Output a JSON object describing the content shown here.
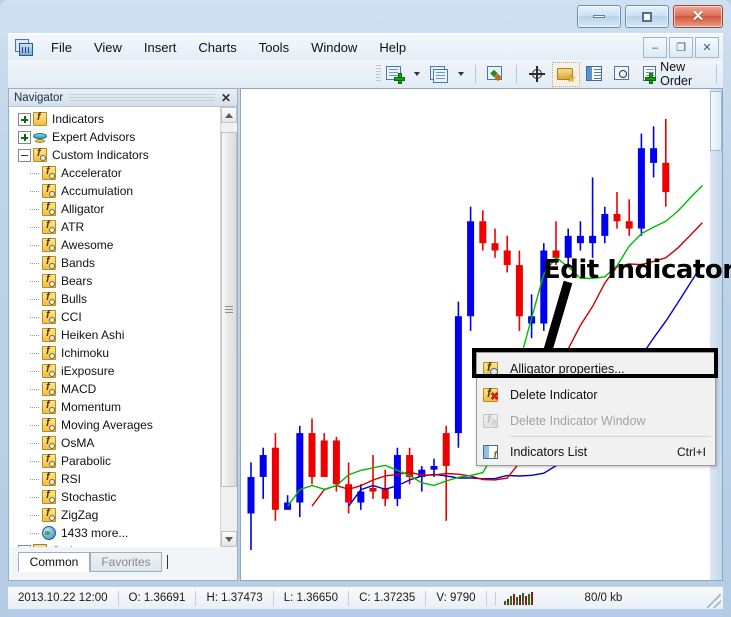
{
  "window": {
    "titlebar_buttons": [
      {
        "name": "minimize",
        "glyph": "minimize"
      },
      {
        "name": "restore",
        "glyph": "restore"
      },
      {
        "name": "close",
        "glyph": "×"
      }
    ]
  },
  "menubar": {
    "logo_icon": "app-chart-icon",
    "items": [
      "File",
      "View",
      "Insert",
      "Charts",
      "Tools",
      "Window",
      "Help"
    ],
    "mdi_buttons": [
      "–",
      "❐",
      "✕"
    ]
  },
  "toolbar": {
    "items": [
      {
        "name": "new-chart-button",
        "icon": "new-chart-icon",
        "label": "",
        "dropdown": true
      },
      {
        "name": "profiles-button",
        "icon": "profiles-icon",
        "label": "",
        "dropdown": true
      },
      {
        "name": "indicators-button",
        "icon": "indicators-icon",
        "label": ""
      },
      {
        "name": "crosshair-button",
        "icon": "crosshair-icon",
        "label": ""
      },
      {
        "name": "objects-button",
        "icon": "favorites-folder-icon",
        "label": ""
      },
      {
        "name": "terminal-button",
        "icon": "list-icon",
        "label": ""
      },
      {
        "name": "data-window-button",
        "icon": "magnifier-icon",
        "label": ""
      },
      {
        "name": "new-order-button",
        "icon": "new-order-icon",
        "label": "New Order"
      }
    ],
    "new_order_label": "New Order"
  },
  "navigator": {
    "title": "Navigator",
    "close_label": "✕",
    "tree": [
      {
        "label": "Indicators",
        "icon": "fx-icon",
        "level": 0,
        "expander": "plus"
      },
      {
        "label": "Expert Advisors",
        "icon": "hat-icon",
        "level": 0,
        "expander": "plus"
      },
      {
        "label": "Custom Indicators",
        "icon": "fx-sub-icon",
        "level": 0,
        "expander": "minus"
      },
      {
        "label": "Accelerator",
        "icon": "fx-sub-icon",
        "level": 1
      },
      {
        "label": "Accumulation",
        "icon": "fx-sub-icon",
        "level": 1
      },
      {
        "label": "Alligator",
        "icon": "fx-sub-icon",
        "level": 1
      },
      {
        "label": "ATR",
        "icon": "fx-sub-icon",
        "level": 1
      },
      {
        "label": "Awesome",
        "icon": "fx-sub-icon",
        "level": 1
      },
      {
        "label": "Bands",
        "icon": "fx-sub-icon",
        "level": 1
      },
      {
        "label": "Bears",
        "icon": "fx-sub-icon",
        "level": 1
      },
      {
        "label": "Bulls",
        "icon": "fx-sub-icon",
        "level": 1
      },
      {
        "label": "CCI",
        "icon": "fx-sub-icon",
        "level": 1
      },
      {
        "label": "Heiken Ashi",
        "icon": "fx-sub-icon",
        "level": 1
      },
      {
        "label": "Ichimoku",
        "icon": "fx-sub-icon",
        "level": 1
      },
      {
        "label": "iExposure",
        "icon": "fx-sub-icon",
        "level": 1
      },
      {
        "label": "MACD",
        "icon": "fx-sub-icon",
        "level": 1
      },
      {
        "label": "Momentum",
        "icon": "fx-sub-icon",
        "level": 1
      },
      {
        "label": "Moving Averages",
        "icon": "fx-sub-icon",
        "level": 1
      },
      {
        "label": "OsMA",
        "icon": "fx-sub-icon",
        "level": 1
      },
      {
        "label": "Parabolic",
        "icon": "fx-sub-icon",
        "level": 1
      },
      {
        "label": "RSI",
        "icon": "fx-sub-icon",
        "level": 1
      },
      {
        "label": "Stochastic",
        "icon": "fx-sub-icon",
        "level": 1
      },
      {
        "label": "ZigZag",
        "icon": "fx-sub-icon",
        "level": 1
      },
      {
        "label": "1433 more...",
        "icon": "globe-icon",
        "level": 1
      },
      {
        "label": "Scripts",
        "icon": "scroll-icon",
        "level": 0,
        "expander": "plus"
      }
    ],
    "tabs": [
      {
        "label": "Common",
        "active": true
      },
      {
        "label": "Favorites",
        "active": false
      }
    ]
  },
  "chart": {
    "annotation": "Edit Indicator"
  },
  "context_menu": {
    "items": [
      {
        "label": "Alligator properties...",
        "icon": "fx-gear-icon",
        "shortcut": "",
        "disabled": false,
        "highlighted": true
      },
      {
        "label": "Delete Indicator",
        "icon": "fx-delete-icon",
        "shortcut": "",
        "disabled": false,
        "highlighted": false
      },
      {
        "label": "Delete Indicator Window",
        "icon": "fx-delete-window-icon",
        "shortcut": "",
        "disabled": true,
        "highlighted": false
      },
      {
        "label": "Indicators List",
        "icon": "indicators-list-icon",
        "shortcut": "Ctrl+I",
        "disabled": false,
        "highlighted": false
      }
    ]
  },
  "statusbar": {
    "datetime": "2013.10.22 12:00",
    "open": "O: 1.36691",
    "high": "H: 1.37473",
    "low": "L: 1.36650",
    "close": "C: 1.37235",
    "volume": "V: 9790",
    "connection_icon": "signal-bars-icon",
    "traffic": "80/0 kb"
  },
  "chart_data": {
    "type": "candlestick",
    "title": "",
    "xlabel": "",
    "ylabel": "",
    "colors": {
      "bull": "#0000ee",
      "bear": "#ee0000",
      "alligator_jaw": "#0000cc",
      "alligator_teeth": "#cc0000",
      "alligator_lips": "#00bb00",
      "background": "#ffffff"
    },
    "candles": [
      {
        "o": 12,
        "h": 26,
        "l": 2,
        "c": 22,
        "dir": "up"
      },
      {
        "o": 22,
        "h": 30,
        "l": 16,
        "c": 28,
        "dir": "up"
      },
      {
        "o": 30,
        "h": 34,
        "l": 10,
        "c": 13,
        "dir": "down"
      },
      {
        "o": 13,
        "h": 17,
        "l": 14,
        "c": 15,
        "dir": "up"
      },
      {
        "o": 15,
        "h": 36,
        "l": 11,
        "c": 34,
        "dir": "up"
      },
      {
        "o": 34,
        "h": 38,
        "l": 20,
        "c": 22,
        "dir": "down"
      },
      {
        "o": 22,
        "h": 34,
        "l": 24,
        "c": 32,
        "dir": "down"
      },
      {
        "o": 32,
        "h": 33,
        "l": 18,
        "c": 20,
        "dir": "down"
      },
      {
        "o": 20,
        "h": 26,
        "l": 12,
        "c": 15,
        "dir": "down"
      },
      {
        "o": 15,
        "h": 20,
        "l": 13,
        "c": 18,
        "dir": "up"
      },
      {
        "o": 18,
        "h": 28,
        "l": 16,
        "c": 19,
        "dir": "down"
      },
      {
        "o": 19,
        "h": 24,
        "l": 14,
        "c": 16,
        "dir": "down"
      },
      {
        "o": 16,
        "h": 30,
        "l": 14,
        "c": 28,
        "dir": "up"
      },
      {
        "o": 28,
        "h": 30,
        "l": 20,
        "c": 22,
        "dir": "down"
      },
      {
        "o": 22,
        "h": 25,
        "l": 18,
        "c": 24,
        "dir": "up"
      },
      {
        "o": 24,
        "h": 27,
        "l": 22,
        "c": 25,
        "dir": "up"
      },
      {
        "o": 25,
        "h": 36,
        "l": 10,
        "c": 34,
        "dir": "down"
      },
      {
        "o": 34,
        "h": 70,
        "l": 30,
        "c": 66,
        "dir": "up"
      },
      {
        "o": 66,
        "h": 96,
        "l": 62,
        "c": 92,
        "dir": "up"
      },
      {
        "o": 92,
        "h": 95,
        "l": 84,
        "c": 86,
        "dir": "down"
      },
      {
        "o": 86,
        "h": 90,
        "l": 82,
        "c": 84,
        "dir": "down"
      },
      {
        "o": 84,
        "h": 88,
        "l": 78,
        "c": 80,
        "dir": "down"
      },
      {
        "o": 80,
        "h": 84,
        "l": 62,
        "c": 66,
        "dir": "down"
      },
      {
        "o": 66,
        "h": 72,
        "l": 60,
        "c": 64,
        "dir": "up"
      },
      {
        "o": 64,
        "h": 86,
        "l": 62,
        "c": 84,
        "dir": "up"
      },
      {
        "o": 84,
        "h": 92,
        "l": 80,
        "c": 82,
        "dir": "down"
      },
      {
        "o": 82,
        "h": 90,
        "l": 80,
        "c": 88,
        "dir": "up"
      },
      {
        "o": 88,
        "h": 92,
        "l": 84,
        "c": 86,
        "dir": "up"
      },
      {
        "o": 86,
        "h": 104,
        "l": 82,
        "c": 88,
        "dir": "up"
      },
      {
        "o": 88,
        "h": 96,
        "l": 86,
        "c": 94,
        "dir": "up"
      },
      {
        "o": 94,
        "h": 100,
        "l": 90,
        "c": 92,
        "dir": "down"
      },
      {
        "o": 92,
        "h": 98,
        "l": 88,
        "c": 90,
        "dir": "down"
      },
      {
        "o": 90,
        "h": 116,
        "l": 88,
        "c": 112,
        "dir": "up"
      },
      {
        "o": 112,
        "h": 118,
        "l": 104,
        "c": 108,
        "dir": "up"
      },
      {
        "o": 108,
        "h": 120,
        "l": 96,
        "c": 100,
        "dir": "down"
      }
    ]
  }
}
